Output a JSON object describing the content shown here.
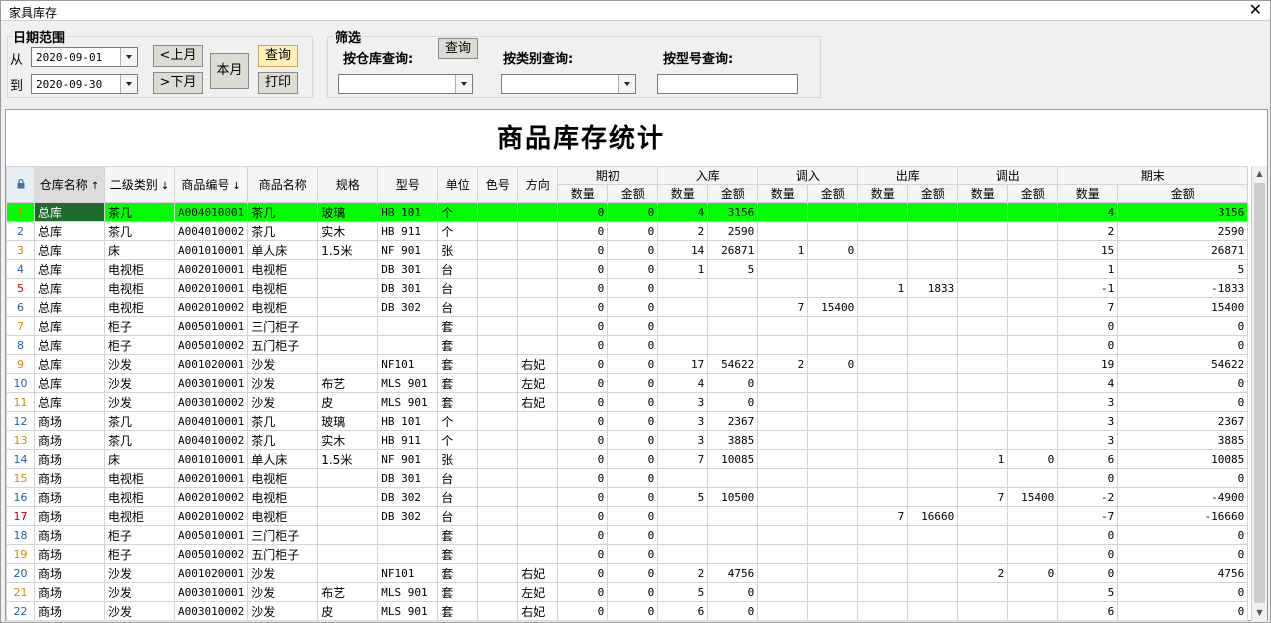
{
  "window": {
    "title": "家具库存",
    "close_glyph": "✕"
  },
  "date_range": {
    "group_label": "日期范围",
    "from_label": "从",
    "to_label": "到",
    "from_value": "2020-09-01",
    "to_value": "2020-09-30",
    "prev_month": "<上月",
    "next_month": ">下月",
    "this_month": "本月",
    "query": "查询",
    "print": "打印"
  },
  "filter": {
    "group_label": "筛选",
    "warehouse_label": "按仓库查询:",
    "query": "查询",
    "category_label": "按类别查询:",
    "model_label": "按型号查询:",
    "warehouse_value": "",
    "category_value": "",
    "model_value": ""
  },
  "report": {
    "title": "商品库存统计",
    "headers": {
      "warehouse": "仓库名称",
      "category": "二级类别",
      "code": "商品编号",
      "name": "商品名称",
      "spec": "规格",
      "model": "型号",
      "unit": "单位",
      "color": "色号",
      "direction": "方向",
      "opening": "期初",
      "in": "入库",
      "transfer_in": "调入",
      "out": "出库",
      "transfer_out": "调出",
      "closing": "期末",
      "qty": "数量",
      "amount": "金额",
      "sort_up": "↑",
      "sort_down": "↓"
    },
    "rows": [
      {
        "n": "1",
        "wh": "总库",
        "cat": "茶几",
        "code": "A004010001",
        "name": "茶几",
        "spec": "玻璃",
        "model": "HB 101",
        "unit": "个",
        "color": "",
        "dir": "",
        "oq": "0",
        "oa": "0",
        "iq": "4",
        "ia": "3156",
        "tiq": "",
        "tia": "",
        "xq": "",
        "xa": "",
        "toq": "",
        "toa": "",
        "cq": "4",
        "ca": "3156"
      },
      {
        "n": "2",
        "wh": "总库",
        "cat": "茶几",
        "code": "A004010002",
        "name": "茶几",
        "spec": "实木",
        "model": "HB 911",
        "unit": "个",
        "color": "",
        "dir": "",
        "oq": "0",
        "oa": "0",
        "iq": "2",
        "ia": "2590",
        "tiq": "",
        "tia": "",
        "xq": "",
        "xa": "",
        "toq": "",
        "toa": "",
        "cq": "2",
        "ca": "2590"
      },
      {
        "n": "3",
        "wh": "总库",
        "cat": "床",
        "code": "A001010001",
        "name": "单人床",
        "spec": "1.5米",
        "model": "NF 901",
        "unit": "张",
        "color": "",
        "dir": "",
        "oq": "0",
        "oa": "0",
        "iq": "14",
        "ia": "26871",
        "tiq": "1",
        "tia": "0",
        "xq": "",
        "xa": "",
        "toq": "",
        "toa": "",
        "cq": "15",
        "ca": "26871"
      },
      {
        "n": "4",
        "wh": "总库",
        "cat": "电视柜",
        "code": "A002010001",
        "name": "电视柜",
        "spec": "",
        "model": "DB 301",
        "unit": "台",
        "color": "",
        "dir": "",
        "oq": "0",
        "oa": "0",
        "iq": "1",
        "ia": "5",
        "tiq": "",
        "tia": "",
        "xq": "",
        "xa": "",
        "toq": "",
        "toa": "",
        "cq": "1",
        "ca": "5"
      },
      {
        "n": "5",
        "wh": "总库",
        "cat": "电视柜",
        "code": "A002010001",
        "name": "电视柜",
        "spec": "",
        "model": "DB 301",
        "unit": "台",
        "color": "",
        "dir": "",
        "oq": "0",
        "oa": "0",
        "iq": "",
        "ia": "",
        "tiq": "",
        "tia": "",
        "xq": "1",
        "xa": "1833",
        "toq": "",
        "toa": "",
        "cq": "-1",
        "ca": "-1833"
      },
      {
        "n": "6",
        "wh": "总库",
        "cat": "电视柜",
        "code": "A002010002",
        "name": "电视柜",
        "spec": "",
        "model": "DB 302",
        "unit": "台",
        "color": "",
        "dir": "",
        "oq": "0",
        "oa": "0",
        "iq": "",
        "ia": "",
        "tiq": "7",
        "tia": "15400",
        "xq": "",
        "xa": "",
        "toq": "",
        "toa": "",
        "cq": "7",
        "ca": "15400"
      },
      {
        "n": "7",
        "wh": "总库",
        "cat": "柜子",
        "code": "A005010001",
        "name": "三门柜子",
        "spec": "",
        "model": "",
        "unit": "套",
        "color": "",
        "dir": "",
        "oq": "0",
        "oa": "0",
        "iq": "",
        "ia": "",
        "tiq": "",
        "tia": "",
        "xq": "",
        "xa": "",
        "toq": "",
        "toa": "",
        "cq": "0",
        "ca": "0"
      },
      {
        "n": "8",
        "wh": "总库",
        "cat": "柜子",
        "code": "A005010002",
        "name": "五门柜子",
        "spec": "",
        "model": "",
        "unit": "套",
        "color": "",
        "dir": "",
        "oq": "0",
        "oa": "0",
        "iq": "",
        "ia": "",
        "tiq": "",
        "tia": "",
        "xq": "",
        "xa": "",
        "toq": "",
        "toa": "",
        "cq": "0",
        "ca": "0"
      },
      {
        "n": "9",
        "wh": "总库",
        "cat": "沙发",
        "code": "A001020001",
        "name": "沙发",
        "spec": "",
        "model": "NF101",
        "unit": "套",
        "color": "",
        "dir": "右妃",
        "oq": "0",
        "oa": "0",
        "iq": "17",
        "ia": "54622",
        "tiq": "2",
        "tia": "0",
        "xq": "",
        "xa": "",
        "toq": "",
        "toa": "",
        "cq": "19",
        "ca": "54622"
      },
      {
        "n": "10",
        "wh": "总库",
        "cat": "沙发",
        "code": "A003010001",
        "name": "沙发",
        "spec": "布艺",
        "model": "MLS 901",
        "unit": "套",
        "color": "",
        "dir": "左妃",
        "oq": "0",
        "oa": "0",
        "iq": "4",
        "ia": "0",
        "tiq": "",
        "tia": "",
        "xq": "",
        "xa": "",
        "toq": "",
        "toa": "",
        "cq": "4",
        "ca": "0"
      },
      {
        "n": "11",
        "wh": "总库",
        "cat": "沙发",
        "code": "A003010002",
        "name": "沙发",
        "spec": "皮",
        "model": "MLS 901",
        "unit": "套",
        "color": "",
        "dir": "右妃",
        "oq": "0",
        "oa": "0",
        "iq": "3",
        "ia": "0",
        "tiq": "",
        "tia": "",
        "xq": "",
        "xa": "",
        "toq": "",
        "toa": "",
        "cq": "3",
        "ca": "0"
      },
      {
        "n": "12",
        "wh": "商场",
        "cat": "茶几",
        "code": "A004010001",
        "name": "茶几",
        "spec": "玻璃",
        "model": "HB 101",
        "unit": "个",
        "color": "",
        "dir": "",
        "oq": "0",
        "oa": "0",
        "iq": "3",
        "ia": "2367",
        "tiq": "",
        "tia": "",
        "xq": "",
        "xa": "",
        "toq": "",
        "toa": "",
        "cq": "3",
        "ca": "2367"
      },
      {
        "n": "13",
        "wh": "商场",
        "cat": "茶几",
        "code": "A004010002",
        "name": "茶几",
        "spec": "实木",
        "model": "HB 911",
        "unit": "个",
        "color": "",
        "dir": "",
        "oq": "0",
        "oa": "0",
        "iq": "3",
        "ia": "3885",
        "tiq": "",
        "tia": "",
        "xq": "",
        "xa": "",
        "toq": "",
        "toa": "",
        "cq": "3",
        "ca": "3885"
      },
      {
        "n": "14",
        "wh": "商场",
        "cat": "床",
        "code": "A001010001",
        "name": "单人床",
        "spec": "1.5米",
        "model": "NF 901",
        "unit": "张",
        "color": "",
        "dir": "",
        "oq": "0",
        "oa": "0",
        "iq": "7",
        "ia": "10085",
        "tiq": "",
        "tia": "",
        "xq": "",
        "xa": "",
        "toq": "1",
        "toa": "0",
        "cq": "6",
        "ca": "10085"
      },
      {
        "n": "15",
        "wh": "商场",
        "cat": "电视柜",
        "code": "A002010001",
        "name": "电视柜",
        "spec": "",
        "model": "DB 301",
        "unit": "台",
        "color": "",
        "dir": "",
        "oq": "0",
        "oa": "0",
        "iq": "",
        "ia": "",
        "tiq": "",
        "tia": "",
        "xq": "",
        "xa": "",
        "toq": "",
        "toa": "",
        "cq": "0",
        "ca": "0"
      },
      {
        "n": "16",
        "wh": "商场",
        "cat": "电视柜",
        "code": "A002010002",
        "name": "电视柜",
        "spec": "",
        "model": "DB 302",
        "unit": "台",
        "color": "",
        "dir": "",
        "oq": "0",
        "oa": "0",
        "iq": "5",
        "ia": "10500",
        "tiq": "",
        "tia": "",
        "xq": "",
        "xa": "",
        "toq": "7",
        "toa": "15400",
        "cq": "-2",
        "ca": "-4900"
      },
      {
        "n": "17",
        "wh": "商场",
        "cat": "电视柜",
        "code": "A002010002",
        "name": "电视柜",
        "spec": "",
        "model": "DB 302",
        "unit": "台",
        "color": "",
        "dir": "",
        "oq": "0",
        "oa": "0",
        "iq": "",
        "ia": "",
        "tiq": "",
        "tia": "",
        "xq": "7",
        "xa": "16660",
        "toq": "",
        "toa": "",
        "cq": "-7",
        "ca": "-16660"
      },
      {
        "n": "18",
        "wh": "商场",
        "cat": "柜子",
        "code": "A005010001",
        "name": "三门柜子",
        "spec": "",
        "model": "",
        "unit": "套",
        "color": "",
        "dir": "",
        "oq": "0",
        "oa": "0",
        "iq": "",
        "ia": "",
        "tiq": "",
        "tia": "",
        "xq": "",
        "xa": "",
        "toq": "",
        "toa": "",
        "cq": "0",
        "ca": "0"
      },
      {
        "n": "19",
        "wh": "商场",
        "cat": "柜子",
        "code": "A005010002",
        "name": "五门柜子",
        "spec": "",
        "model": "",
        "unit": "套",
        "color": "",
        "dir": "",
        "oq": "0",
        "oa": "0",
        "iq": "",
        "ia": "",
        "tiq": "",
        "tia": "",
        "xq": "",
        "xa": "",
        "toq": "",
        "toa": "",
        "cq": "0",
        "ca": "0"
      },
      {
        "n": "20",
        "wh": "商场",
        "cat": "沙发",
        "code": "A001020001",
        "name": "沙发",
        "spec": "",
        "model": "NF101",
        "unit": "套",
        "color": "",
        "dir": "右妃",
        "oq": "0",
        "oa": "0",
        "iq": "2",
        "ia": "4756",
        "tiq": "",
        "tia": "",
        "xq": "",
        "xa": "",
        "toq": "2",
        "toa": "0",
        "cq": "0",
        "ca": "4756"
      },
      {
        "n": "21",
        "wh": "商场",
        "cat": "沙发",
        "code": "A003010001",
        "name": "沙发",
        "spec": "布艺",
        "model": "MLS 901",
        "unit": "套",
        "color": "",
        "dir": "左妃",
        "oq": "0",
        "oa": "0",
        "iq": "5",
        "ia": "0",
        "tiq": "",
        "tia": "",
        "xq": "",
        "xa": "",
        "toq": "",
        "toa": "",
        "cq": "5",
        "ca": "0"
      },
      {
        "n": "22",
        "wh": "商场",
        "cat": "沙发",
        "code": "A003010002",
        "name": "沙发",
        "spec": "皮",
        "model": "MLS 901",
        "unit": "套",
        "color": "",
        "dir": "右妃",
        "oq": "0",
        "oa": "0",
        "iq": "6",
        "ia": "0",
        "tiq": "",
        "tia": "",
        "xq": "",
        "xa": "",
        "toq": "",
        "toa": "",
        "cq": "6",
        "ca": "0"
      }
    ],
    "selected_row": "1"
  },
  "colors": {
    "selected_row": "#00ff00",
    "focus_cell": "#1f6b2d",
    "row_number_odd": "#d28a00",
    "row_number_even": "#1f5fb0",
    "row_number_alert": "#c00000",
    "yellow_button": "#fff0b8"
  },
  "icons": {
    "lock": "lock-icon",
    "close": "close-icon",
    "dropdown": "chevron-down-icon"
  }
}
